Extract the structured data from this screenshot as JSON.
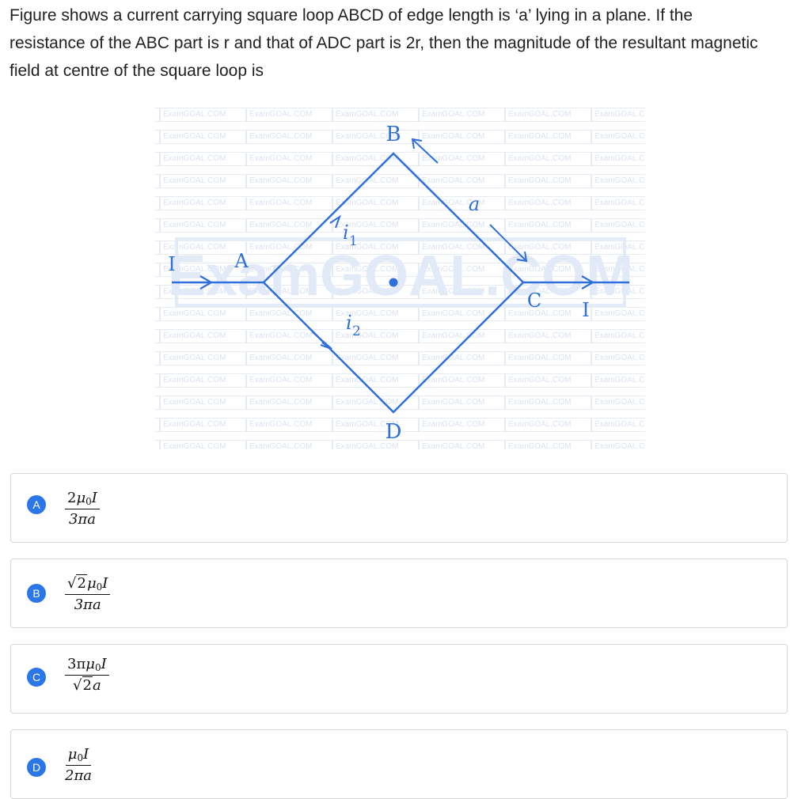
{
  "question": {
    "text": "Figure shows a current carrying square loop ABCD of edge length is ‘a’ lying in a plane. If the resistance of the ABC part is r and that of ADC part is 2r, then the magnitude of the resultant magnetic field at centre of the square loop is"
  },
  "figure": {
    "watermark_small": "ExamGOAL.COM",
    "watermark_large": "ExamGOAL.COM",
    "labels": {
      "A": "A",
      "B": "B",
      "C": "C",
      "D": "D",
      "I_in": "I",
      "I_out": "I",
      "i1_base": "i",
      "i1_sub": "1",
      "i2_base": "i",
      "i2_sub": "2",
      "edge": "a"
    },
    "line_color": "#2f6fdb"
  },
  "options": [
    {
      "letter": "A",
      "num_pre": "2",
      "num_mu": "μ",
      "num_mu_sub": "0",
      "num_post": "I",
      "den": "3πa",
      "sqrt_in_num": "",
      "sqrt_in_den": ""
    },
    {
      "letter": "B",
      "num_pre": "",
      "num_mu": "μ",
      "num_mu_sub": "0",
      "num_post": "I",
      "den": "3πa",
      "sqrt_in_num": "2",
      "sqrt_in_den": ""
    },
    {
      "letter": "C",
      "num_pre": "3π",
      "num_mu": "μ",
      "num_mu_sub": "0",
      "num_post": "I",
      "den": "a",
      "sqrt_in_num": "",
      "sqrt_in_den": "2"
    },
    {
      "letter": "D",
      "num_pre": "",
      "num_mu": "μ",
      "num_mu_sub": "0",
      "num_post": "I",
      "den": "2πa",
      "sqrt_in_num": "",
      "sqrt_in_den": ""
    }
  ]
}
